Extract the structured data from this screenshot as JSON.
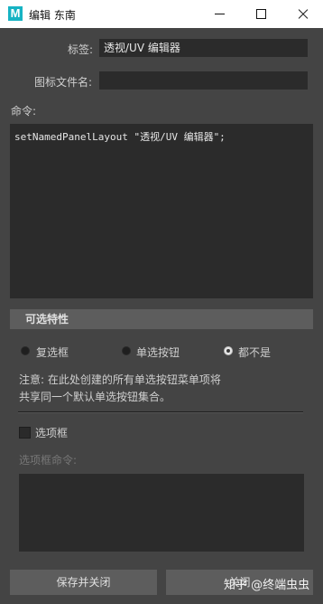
{
  "window": {
    "title": "编辑 东南",
    "app_icon_letter": "M",
    "accent_color": "#16b3c3"
  },
  "form": {
    "label_field": {
      "label": "标签:",
      "value": "透视/UV 编辑器"
    },
    "icon_file_field": {
      "label": "图标文件名:",
      "value": ""
    },
    "command_label": "命令:",
    "command_text": "setNamedPanelLayout \"透视/UV 编辑器\";"
  },
  "selectability": {
    "header": "可选特性",
    "options": [
      {
        "label": "复选框",
        "selected": false
      },
      {
        "label": "单选按钮",
        "selected": false
      },
      {
        "label": "都不是",
        "selected": true
      }
    ],
    "note_line1": "注意: 在此处创建的所有单选按钮菜单项将",
    "note_line2": "共享同一个默认单选按钮集合。"
  },
  "option_box": {
    "checkbox_label": "选项框",
    "checked": false,
    "command_label": "选项框命令:",
    "command_value": ""
  },
  "buttons": {
    "save_close": "保存并关闭",
    "close": "关闭"
  },
  "watermark": "知乎 @终端虫虫"
}
